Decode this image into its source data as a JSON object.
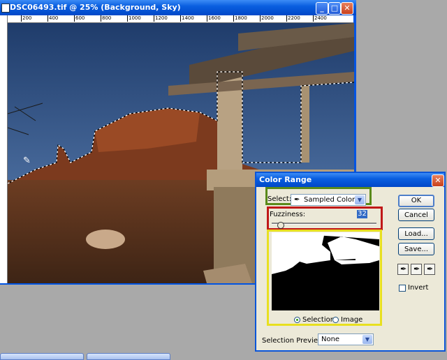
{
  "document": {
    "title": "DSC06493.tif @ 25% (Background, Sky)",
    "ruler_ticks": [
      "200",
      "400",
      "600",
      "800",
      "1000",
      "1200",
      "1400",
      "1600",
      "1800",
      "2000",
      "2200",
      "2400"
    ],
    "minimize_glyph": "_",
    "maximize_glyph": "□",
    "close_glyph": "✕"
  },
  "dialog": {
    "title": "Color Range",
    "close_glyph": "✕",
    "select_label": "Select:",
    "select_value": "Sampled Colors",
    "fuzziness_label": "Fuzziness:",
    "fuzziness_value": "32",
    "fuzziness_fraction": 0.08,
    "radio_selection": "Selection",
    "radio_image": "Image",
    "selected_radio": "Selection",
    "preview_label": "Selection Preview:",
    "preview_value": "None",
    "buttons": {
      "ok": "OK",
      "cancel": "Cancel",
      "load": "Load...",
      "save": "Save..."
    },
    "invert_label": "Invert",
    "invert_checked": false,
    "highlight_colors": {
      "select": "#5a8a1a",
      "fuzziness": "#c01818",
      "preview": "#e8e020"
    }
  },
  "icons": [
    "eyedropper-icon",
    "eyedropper-plus-icon",
    "eyedropper-minus-icon",
    "dropdown-arrow-icon",
    "cursor-eyedropper-icon"
  ]
}
